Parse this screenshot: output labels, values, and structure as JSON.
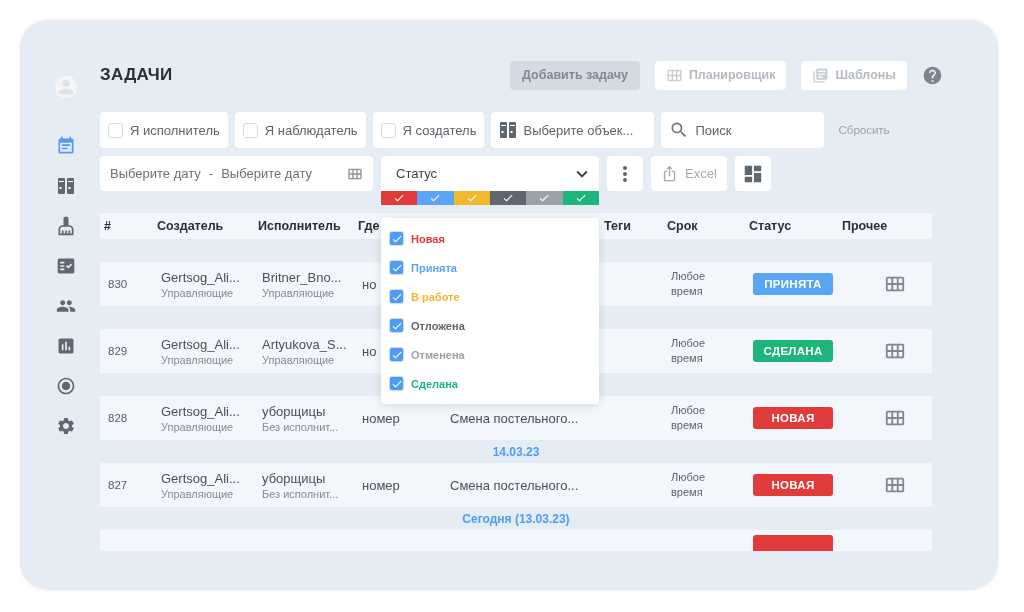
{
  "sidebar": {
    "items": [
      {
        "selected": true
      },
      {
        "selected": false
      },
      {
        "selected": false
      },
      {
        "selected": false
      },
      {
        "selected": false
      },
      {
        "selected": false
      },
      {
        "selected": false
      },
      {
        "selected": false
      }
    ]
  },
  "header": {
    "title": "ЗАДАЧИ",
    "add_button": {
      "label": "Добавить задачу",
      "disabled": true
    },
    "buttons": [
      {
        "kind": "planner",
        "label": "Планировщик"
      },
      {
        "kind": "templates",
        "label": "Шаблоны"
      }
    ]
  },
  "filters": {
    "checkboxes": [
      {
        "label": "Я исполнитель",
        "checked": false
      },
      {
        "label": "Я наблюдатель",
        "checked": false
      },
      {
        "label": "Я создатель",
        "checked": false
      }
    ],
    "object_select": {
      "placeholder": "Выберите объек..."
    },
    "search": {
      "placeholder": "Поиск"
    },
    "reset": "Сбросить",
    "date_from": {
      "placeholder": "Выберите дату"
    },
    "date_separator": "-",
    "date_to": {
      "placeholder": "Выберите дату"
    },
    "status_select": {
      "label": "Статус",
      "expanded": true,
      "options": [
        {
          "label": "Новая",
          "color": "#e03a3a",
          "checked": true
        },
        {
          "label": "Принята",
          "color": "#5aa5f5",
          "checked": true
        },
        {
          "label": "В работе",
          "color": "#f0b92d",
          "checked": true
        },
        {
          "label": "Отложена",
          "color": "#5f6770",
          "checked": true
        },
        {
          "label": "Отменена",
          "color": "#9aa1a8",
          "checked": true
        },
        {
          "label": "Сделана",
          "color": "#1db57c",
          "checked": true
        }
      ]
    },
    "excel": {
      "label": "Excel",
      "disabled": true
    }
  },
  "table": {
    "columns": [
      "#",
      "Создатель",
      "Исполнитель",
      "Где",
      "Теги",
      "Срок",
      "Статус",
      "Прочее"
    ],
    "rows": [
      {
        "number": "830",
        "creator": "Gertsog_Ali...",
        "creator_group": "Управляющие",
        "executor": "Britner_Bno...",
        "executor_group": "Управляющие",
        "place": "но",
        "deadline": "Любое время",
        "status": "ПРИНЯТА",
        "color": "#5aa5f5"
      },
      {
        "number": "829",
        "creator": "Gertsog_Ali...",
        "creator_group": "Управляющие",
        "executor": "Artyukova_S...",
        "executor_group": "Управляющие",
        "place": "но",
        "deadline": "Любое время",
        "status": "СДЕЛАНА",
        "color": "#1db57c"
      },
      {
        "number": "828",
        "creator": "Gertsog_Ali...",
        "creator_group": "Управляющие",
        "executor": "уборщицы",
        "executor_group": "Без исполнит...",
        "place": "номер",
        "title": "Смена постельного...",
        "deadline": "Любое время",
        "status": "НОВАЯ",
        "color": "#e03a3a"
      },
      {
        "date": "14.03.23",
        "number": "827",
        "creator": "Gertsog_Ali...",
        "creator_group": "Управляющие",
        "executor": "уборщицы",
        "executor_group": "Без исполнит...",
        "place": "номер",
        "title": "Смена постельного...",
        "deadline": "Любое время",
        "status": "НОВАЯ",
        "color": "#e03a3a"
      },
      {
        "date": "Сегодня (13.03.23)",
        "kind": "partial",
        "color": "#e03a3a"
      }
    ]
  }
}
